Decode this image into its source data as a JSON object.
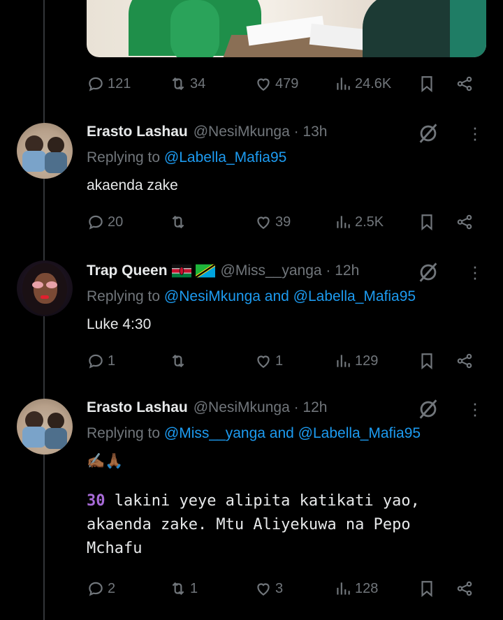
{
  "top_post": {
    "replies": "121",
    "reposts": "34",
    "likes": "479",
    "views": "24.6K"
  },
  "tweets": [
    {
      "name": "Erasto Lashau",
      "handle": "@NesiMkunga · 13h",
      "replying_prefix": "Replying to ",
      "replying_to": "@Labella_Mafia95",
      "text": "akaenda zake",
      "replies": "20",
      "reposts": "",
      "likes": "39",
      "views": "2.5K"
    },
    {
      "name": "Trap Queen",
      "flags": [
        "kenya-flag",
        "tanzania-flag"
      ],
      "handle": "@Miss__yanga · 12h",
      "replying_prefix": "Replying to ",
      "replying_to": "@NesiMkunga and @Labella_Mafia95",
      "text": "Luke 4:30",
      "replies": "1",
      "reposts": "",
      "likes": "1",
      "views": "129"
    },
    {
      "name": "Erasto Lashau",
      "handle": "@NesiMkunga · 12h",
      "replying_prefix": "Replying to ",
      "replying_to": "@Miss__yanga and @Labella_Mafia95",
      "emoji": "✍🏾🙏🏾",
      "verse_number": "30",
      "verse_text": " lakini yeye alipita katikati yao, akaenda zake. Mtu Aliyekuwa na Pepo Mchafu",
      "replies": "2",
      "reposts": "1",
      "likes": "3",
      "views": "128"
    }
  ],
  "colors": {
    "background": "#000000",
    "text": "#e7e9ea",
    "muted": "#71767b",
    "link": "#1d9bf0",
    "verse_number": "#a86bd8"
  }
}
